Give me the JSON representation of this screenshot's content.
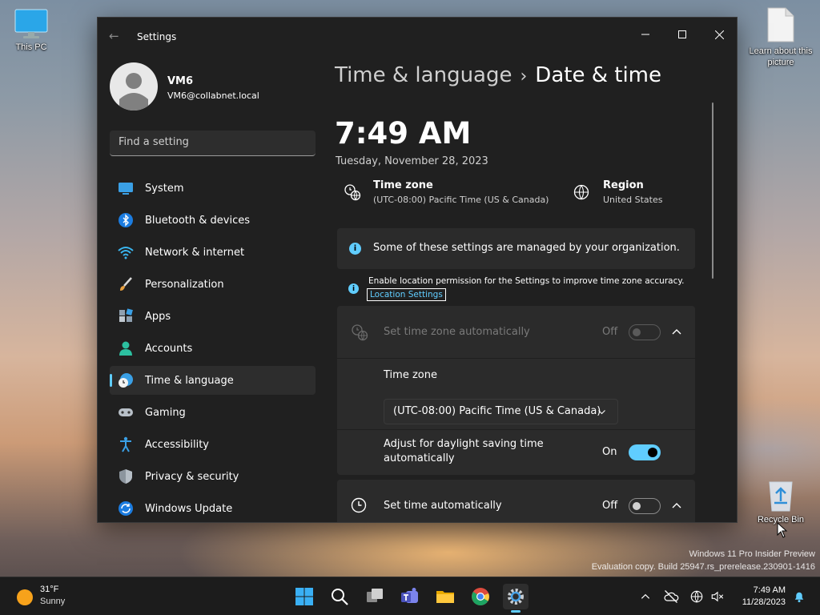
{
  "desktop": {
    "this_pc_label": "This PC",
    "learn_label": "Learn about this picture",
    "recycle_label": "Recycle Bin",
    "watermark_line1": "Windows 11 Pro Insider Preview",
    "watermark_line2": "Evaluation copy. Build 25947.rs_prerelease.230901-1416"
  },
  "window": {
    "title": "Settings"
  },
  "user": {
    "name": "VM6",
    "email": "VM6@collabnet.local"
  },
  "search": {
    "placeholder": "Find a setting"
  },
  "nav": [
    {
      "label": "System",
      "icon": "system-icon"
    },
    {
      "label": "Bluetooth & devices",
      "icon": "bluetooth-icon"
    },
    {
      "label": "Network & internet",
      "icon": "wifi-icon"
    },
    {
      "label": "Personalization",
      "icon": "brush-icon"
    },
    {
      "label": "Apps",
      "icon": "apps-icon"
    },
    {
      "label": "Accounts",
      "icon": "person-icon"
    },
    {
      "label": "Time & language",
      "icon": "globe-clock-icon",
      "selected": true
    },
    {
      "label": "Gaming",
      "icon": "gamepad-icon"
    },
    {
      "label": "Accessibility",
      "icon": "accessibility-icon"
    },
    {
      "label": "Privacy & security",
      "icon": "shield-icon"
    },
    {
      "label": "Windows Update",
      "icon": "update-icon"
    }
  ],
  "breadcrumb": {
    "parent": "Time & language",
    "separator": "›",
    "current": "Date & time"
  },
  "clock": {
    "time": "7:49 AM",
    "date": "Tuesday, November 28, 2023"
  },
  "timezone_info": {
    "title": "Time zone",
    "value": "(UTC-08:00) Pacific Time (US & Canada)"
  },
  "region_info": {
    "title": "Region",
    "value": "United States"
  },
  "notices": {
    "managed": "Some of these settings are managed by your organization.",
    "location": "Enable location permission for the Settings to improve time zone accuracy.",
    "location_link": "Location Settings"
  },
  "settings": {
    "tz_auto_label": "Set time zone automatically",
    "tz_auto_state": "Off",
    "tz_label": "Time zone",
    "tz_dropdown_value": "(UTC-08:00) Pacific Time (US & Canada)",
    "dst_label_1": "Adjust for daylight saving time",
    "dst_label_2": "automatically",
    "dst_state": "On",
    "time_auto_label": "Set time automatically",
    "time_auto_state": "Off"
  },
  "taskbar": {
    "weather_temp": "31°F",
    "weather_desc": "Sunny",
    "tray_time": "7:49 AM",
    "tray_date": "11/28/2023"
  },
  "colors": {
    "accent": "#60cdff",
    "window_bg": "#202020",
    "card_bg": "#2b2b2b"
  }
}
